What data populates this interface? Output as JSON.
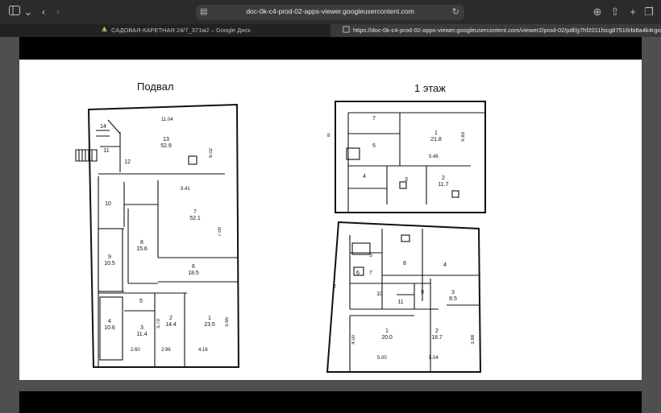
{
  "browser": {
    "url": "doc-0k-c4-prod-02-apps-viewer.googleusercontent.com",
    "tabs": [
      {
        "label": "САДОВАЯ-КАРЕТНАЯ 24/7_371м2 – Google Диск",
        "active": false
      },
      {
        "label": "https://doc-0k-c4-prod-02-apps-viewer.googleusercontent.com/viewer2/prod-02/pdf/g7hf2011hicg87516rbi8a4k4rgoa719/acug...",
        "active": true
      }
    ]
  },
  "document": {
    "basement": {
      "title": "Подвал",
      "rooms": [
        {
          "id": "13",
          "area": "52.9"
        },
        {
          "id": "11",
          "area": ""
        },
        {
          "id": "12",
          "area": ""
        },
        {
          "id": "10",
          "area": ""
        },
        {
          "id": "7",
          "area": "52.1"
        },
        {
          "id": "8",
          "area": "15.6"
        },
        {
          "id": "9",
          "area": "10.5"
        },
        {
          "id": "6",
          "area": "18.5"
        },
        {
          "id": "5",
          "area": ""
        },
        {
          "id": "4",
          "area": "10.6"
        },
        {
          "id": "3",
          "area": "11.4"
        },
        {
          "id": "2",
          "area": "14.4"
        },
        {
          "id": "1",
          "area": "23.5"
        },
        {
          "id": "14",
          "area": ""
        }
      ],
      "dims": {
        "d1104": "11.04",
        "d602": "6.02",
        "d941": "9.41",
        "d700": "7.00",
        "d570": "5.70",
        "d565": "5.65",
        "d260": "2.60",
        "d296": "2.96",
        "d416": "4.16"
      }
    },
    "floor1": {
      "title": "1 этаж",
      "upper": {
        "rooms": [
          {
            "id": "7",
            "area": ""
          },
          {
            "id": "1",
            "area": "21.8"
          },
          {
            "id": "5",
            "area": ""
          },
          {
            "id": "4",
            "area": ""
          },
          {
            "id": "3",
            "area": ""
          },
          {
            "id": "2",
            "area": "11.7"
          }
        ],
        "dims": {
          "d8": "8",
          "d983": "9.83",
          "d546": "5.46"
        }
      },
      "lower": {
        "rooms": [
          {
            "id": "5",
            "area": ""
          },
          {
            "id": "8",
            "area": ""
          },
          {
            "id": "4",
            "area": ""
          },
          {
            "id": "7",
            "area": ""
          },
          {
            "id": "6",
            "area": ""
          },
          {
            "id": "9",
            "area": ""
          },
          {
            "id": "3",
            "area": "8.5"
          },
          {
            "id": "10",
            "area": ""
          },
          {
            "id": "11",
            "area": ""
          },
          {
            "id": "1",
            "area": "20.0"
          },
          {
            "id": "2",
            "area": "18.7"
          }
        ],
        "dims": {
          "d7": "7",
          "d400": "4.00",
          "d500": "5.00",
          "d504": "5.04",
          "d388": "3.88"
        }
      }
    }
  }
}
